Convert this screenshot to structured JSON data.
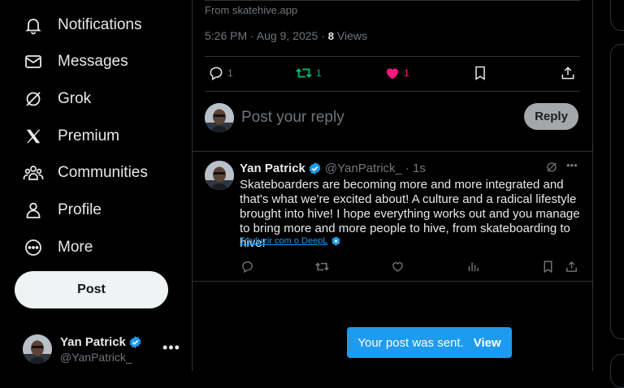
{
  "sidebar": {
    "items": [
      {
        "label": "Notifications",
        "icon": "bell-icon"
      },
      {
        "label": "Messages",
        "icon": "envelope-icon"
      },
      {
        "label": "Grok",
        "icon": "grok-icon"
      },
      {
        "label": "Premium",
        "icon": "x-logo-icon"
      },
      {
        "label": "Communities",
        "icon": "people-icon"
      },
      {
        "label": "Profile",
        "icon": "person-icon"
      },
      {
        "label": "More",
        "icon": "more-circle-icon"
      }
    ],
    "post_label": "Post",
    "account": {
      "name": "Yan Patrick",
      "handle": "@YanPatrick_",
      "more": "•••"
    }
  },
  "tweet": {
    "source": "From skatehive.app",
    "time": "5:26 PM · Aug 9, 2025 ·",
    "views_count": "8",
    "views_label": "Views",
    "stats": {
      "replies": "1",
      "reposts": "1",
      "likes": "1"
    }
  },
  "reply_box": {
    "placeholder": "Post your reply",
    "button": "Reply"
  },
  "reply_post": {
    "name": "Yan Patrick",
    "handle": "@YanPatrick_",
    "time": "· 1s",
    "text": "Skateboarders are becoming more and more integrated and that's what we're excited about! A culture and a radical lifestyle brought into hive! I hope everything works out and you manage to bring more and more people to hive, from skateboarding to hive!",
    "translate": "Traduzir com o DeepL"
  },
  "toast": {
    "message": "Your post was sent.",
    "action": "View"
  },
  "colors": {
    "accent": "#1d9bf0",
    "repost": "#00ba7c",
    "like": "#f91880",
    "muted": "#71767b"
  }
}
